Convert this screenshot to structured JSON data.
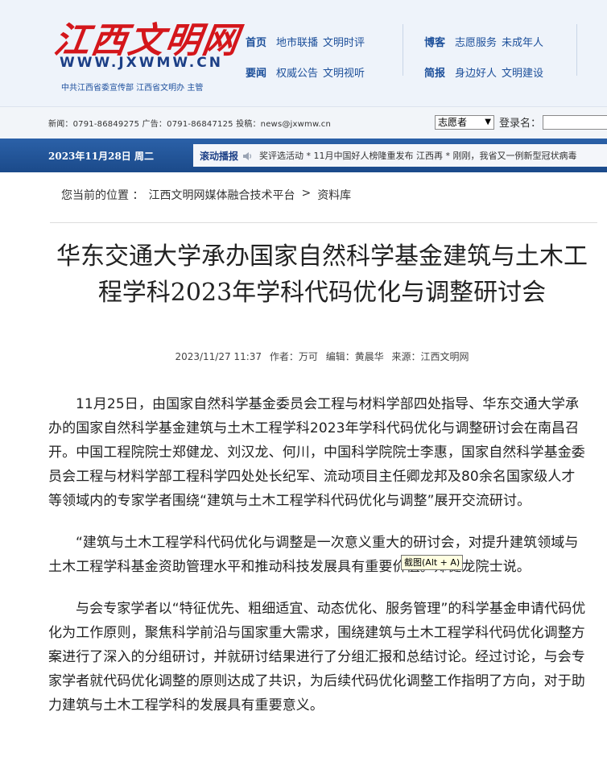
{
  "header": {
    "logo_text": "江西文明网",
    "logo_url": "WWW.JXWMW.CN",
    "logo_sub": "中共江西省委宣传部  江西省文明办  主管",
    "nav_group1": {
      "row1": {
        "lead": "首页",
        "links": [
          "地市联播",
          "文明时评"
        ]
      },
      "row2": {
        "lead": "要闻",
        "links": [
          "权威公告",
          "文明视听"
        ]
      }
    },
    "nav_group2": {
      "row1": {
        "lead": "博客",
        "links": [
          "志愿服务",
          "未成年人"
        ]
      },
      "row2": {
        "lead": "简报",
        "links": [
          "身边好人",
          "文明建设"
        ]
      }
    }
  },
  "infobar": {
    "contact": "新闻：0791-86849275   广告：0791-86847125   投稿：news@jxwmw.cn",
    "select_value": "志愿者",
    "login_label": "登录名："
  },
  "datebar": {
    "date": "2023年11月28日 周二",
    "ticker_label": "滚动播报",
    "ticker_text": "奖评选活动 * 11月中国好人榜隆重发布 江西再 * 刚刚，我省又一例新型冠状病毒"
  },
  "breadcrumb": {
    "label": "您当前的位置 ：",
    "items": [
      "江西文明网媒体融合技术平台",
      "资料库"
    ],
    "separator": ">"
  },
  "article": {
    "title": "华东交通大学承办国家自然科学基金建筑与土木工程学科2023年学科代码优化与调整研讨会",
    "datetime": "2023/11/27 11:37",
    "author": "作者：万可",
    "editor": "编辑：黄晨华",
    "source": "来源：江西文明网",
    "paragraphs": [
      "11月25日，由国家自然科学基金委员会工程与材料学部四处指导、华东交通大学承办的国家自然科学基金建筑与土木工程学科2023年学科代码优化与调整研讨会在南昌召开。中国工程院院士郑健龙、刘汉龙、何川，中国科学院院士李惠，国家自然科学基金委员会工程与材料学部工程科学四处处长纪军、流动项目主任卿龙邦及80余名国家级人才等领域内的专家学者围绕“建筑与土木工程学科代码优化与调整”展开交流研讨。",
      "“建筑与土木工程学科代码优化与调整是一次意义重大的研讨会，对提升建筑领域与土木工程学科基金资助管理水平和推动科技发展具有重要价值。”郑健龙院士说。",
      "与会专家学者以“特征优先、粗细适宜、动态优化、服务管理”的科学基金申请代码优化为工作原则，聚焦科学前沿与国家重大需求，围绕建筑与土木工程学科代码优化调整方案进行了深入的分组研讨，并就研讨结果进行了分组汇报和总结讨论。经过讨论，与会专家学者就代码优化调整的原则达成了共识，为后续代码优化调整工作指明了方向，对于助力建筑与土木工程学科的发展具有重要意义。"
    ]
  },
  "tooltip": "截图(Alt + A)"
}
